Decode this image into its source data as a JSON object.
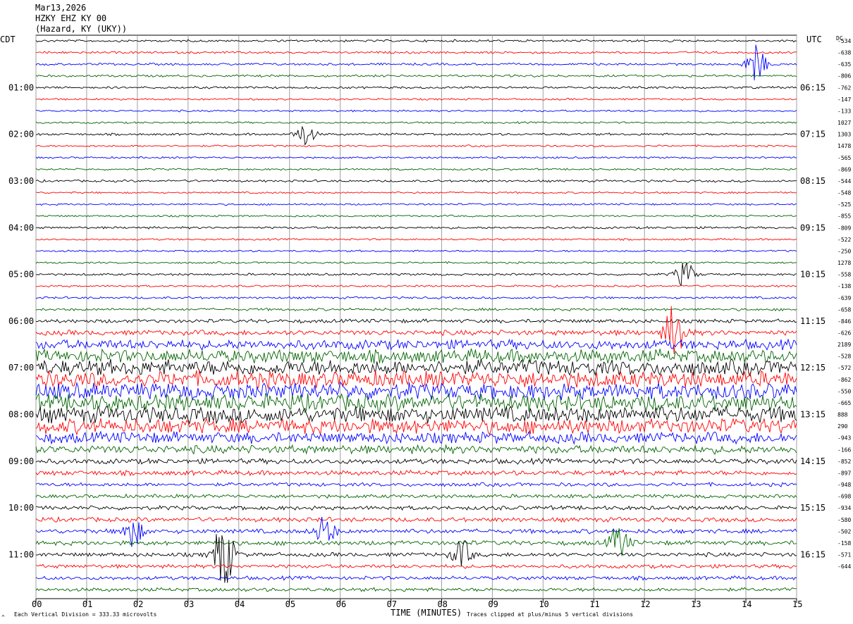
{
  "header": {
    "date": "Mar13,2026",
    "station": "HZKY EHZ KY 00",
    "location": "(Hazard, KY (UKY))"
  },
  "left_zone": "CDT",
  "right_zone": "UTC",
  "dc_label": "DC",
  "footer": {
    "scale": "Each Vertical Division =  333.33 microvolts",
    "clip_note": "Traces clipped at plus/minus 5 vertical divisions",
    "corner_mark": "^"
  },
  "colors": {
    "trace_cycle": [
      "#000000",
      "#ff0000",
      "#0000ff",
      "#006400"
    ],
    "grid": "#a0a0a0"
  },
  "chart_data": {
    "type": "line",
    "title": "",
    "xlabel": "TIME (MINUTES)",
    "ylabel": "",
    "xlim": [
      0,
      15
    ],
    "x_ticks": [
      "00",
      "01",
      "02",
      "03",
      "04",
      "05",
      "06",
      "07",
      "08",
      "09",
      "10",
      "11",
      "12",
      "13",
      "14",
      "15"
    ],
    "rows": 48,
    "left_time_labels": [
      {
        "row": 4,
        "text": "01:00"
      },
      {
        "row": 8,
        "text": "02:00"
      },
      {
        "row": 12,
        "text": "03:00"
      },
      {
        "row": 16,
        "text": "04:00"
      },
      {
        "row": 20,
        "text": "05:00"
      },
      {
        "row": 24,
        "text": "06:00"
      },
      {
        "row": 28,
        "text": "07:00"
      },
      {
        "row": 32,
        "text": "08:00"
      },
      {
        "row": 36,
        "text": "09:00"
      },
      {
        "row": 40,
        "text": "10:00"
      },
      {
        "row": 44,
        "text": "11:00"
      }
    ],
    "right_time_labels": [
      {
        "row": 4,
        "text": "06:15"
      },
      {
        "row": 8,
        "text": "07:15"
      },
      {
        "row": 12,
        "text": "08:15"
      },
      {
        "row": 16,
        "text": "09:15"
      },
      {
        "row": 20,
        "text": "10:15"
      },
      {
        "row": 24,
        "text": "11:15"
      },
      {
        "row": 28,
        "text": "12:15"
      },
      {
        "row": 32,
        "text": "13:15"
      },
      {
        "row": 36,
        "text": "14:15"
      },
      {
        "row": 40,
        "text": "15:15"
      },
      {
        "row": 44,
        "text": "16:15"
      }
    ],
    "dc_offsets": [
      "-534",
      "-638",
      "-635",
      "-806",
      "-762",
      "-147",
      "-133",
      "1027",
      "1303",
      "1478",
      "-565",
      "-869",
      "-544",
      "-548",
      "-525",
      "-855",
      "-809",
      "-522",
      "-250",
      "1278",
      "-558",
      "-138",
      "-639",
      "-658",
      "-846",
      "-626",
      "2189",
      "-528",
      "-572",
      "-862",
      "-550",
      "-665",
      "888",
      "290",
      "-943",
      "-166",
      "-852",
      "-897",
      "-948",
      "-698",
      "-934",
      "-580",
      "-502",
      "-158",
      "-571",
      "-644"
    ],
    "amplitude_profile": [
      0.6,
      0.6,
      0.6,
      0.6,
      0.6,
      0.5,
      0.5,
      0.5,
      0.6,
      0.5,
      0.5,
      0.5,
      0.6,
      0.5,
      0.5,
      0.5,
      0.6,
      0.5,
      0.5,
      0.5,
      0.6,
      0.5,
      0.6,
      0.7,
      1.0,
      1.4,
      2.6,
      3.6,
      4.2,
      4.4,
      4.4,
      4.6,
      4.4,
      4.0,
      3.0,
      2.2,
      1.4,
      1.3,
      1.0,
      1.0,
      1.1,
      1.2,
      1.2,
      1.2,
      1.1,
      1.0,
      1.0,
      1.0
    ],
    "events": [
      {
        "row": 2,
        "minute": 14.2,
        "amp": 3.0
      },
      {
        "row": 8,
        "minute": 5.3,
        "amp": 1.8
      },
      {
        "row": 20,
        "minute": 12.8,
        "amp": 2.0
      },
      {
        "row": 25,
        "minute": 12.6,
        "amp": 5.0
      },
      {
        "row": 42,
        "minute": 1.9,
        "amp": 2.5
      },
      {
        "row": 42,
        "minute": 5.7,
        "amp": 2.4
      },
      {
        "row": 43,
        "minute": 11.5,
        "amp": 2.6
      },
      {
        "row": 44,
        "minute": 8.4,
        "amp": 2.3
      },
      {
        "row": 44,
        "minute": 3.7,
        "amp": 6.0
      }
    ]
  }
}
